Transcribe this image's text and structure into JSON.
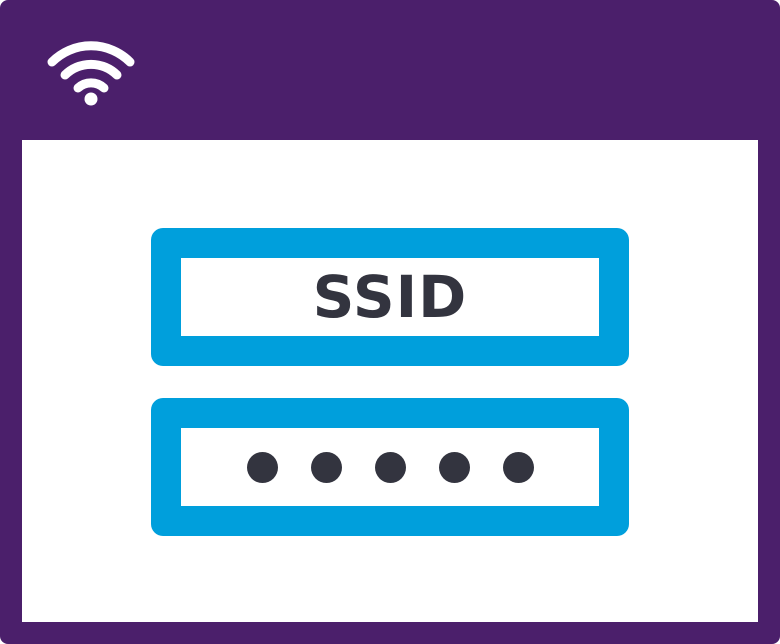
{
  "colors": {
    "frame": "#4b1f6b",
    "accent": "#009fdc",
    "text": "#33343f",
    "content": "#ffffff",
    "icon": "#ffffff"
  },
  "titlebar": {
    "icon": "wifi-icon"
  },
  "form": {
    "ssid_label": "SSID",
    "password_mask_count": 5
  }
}
